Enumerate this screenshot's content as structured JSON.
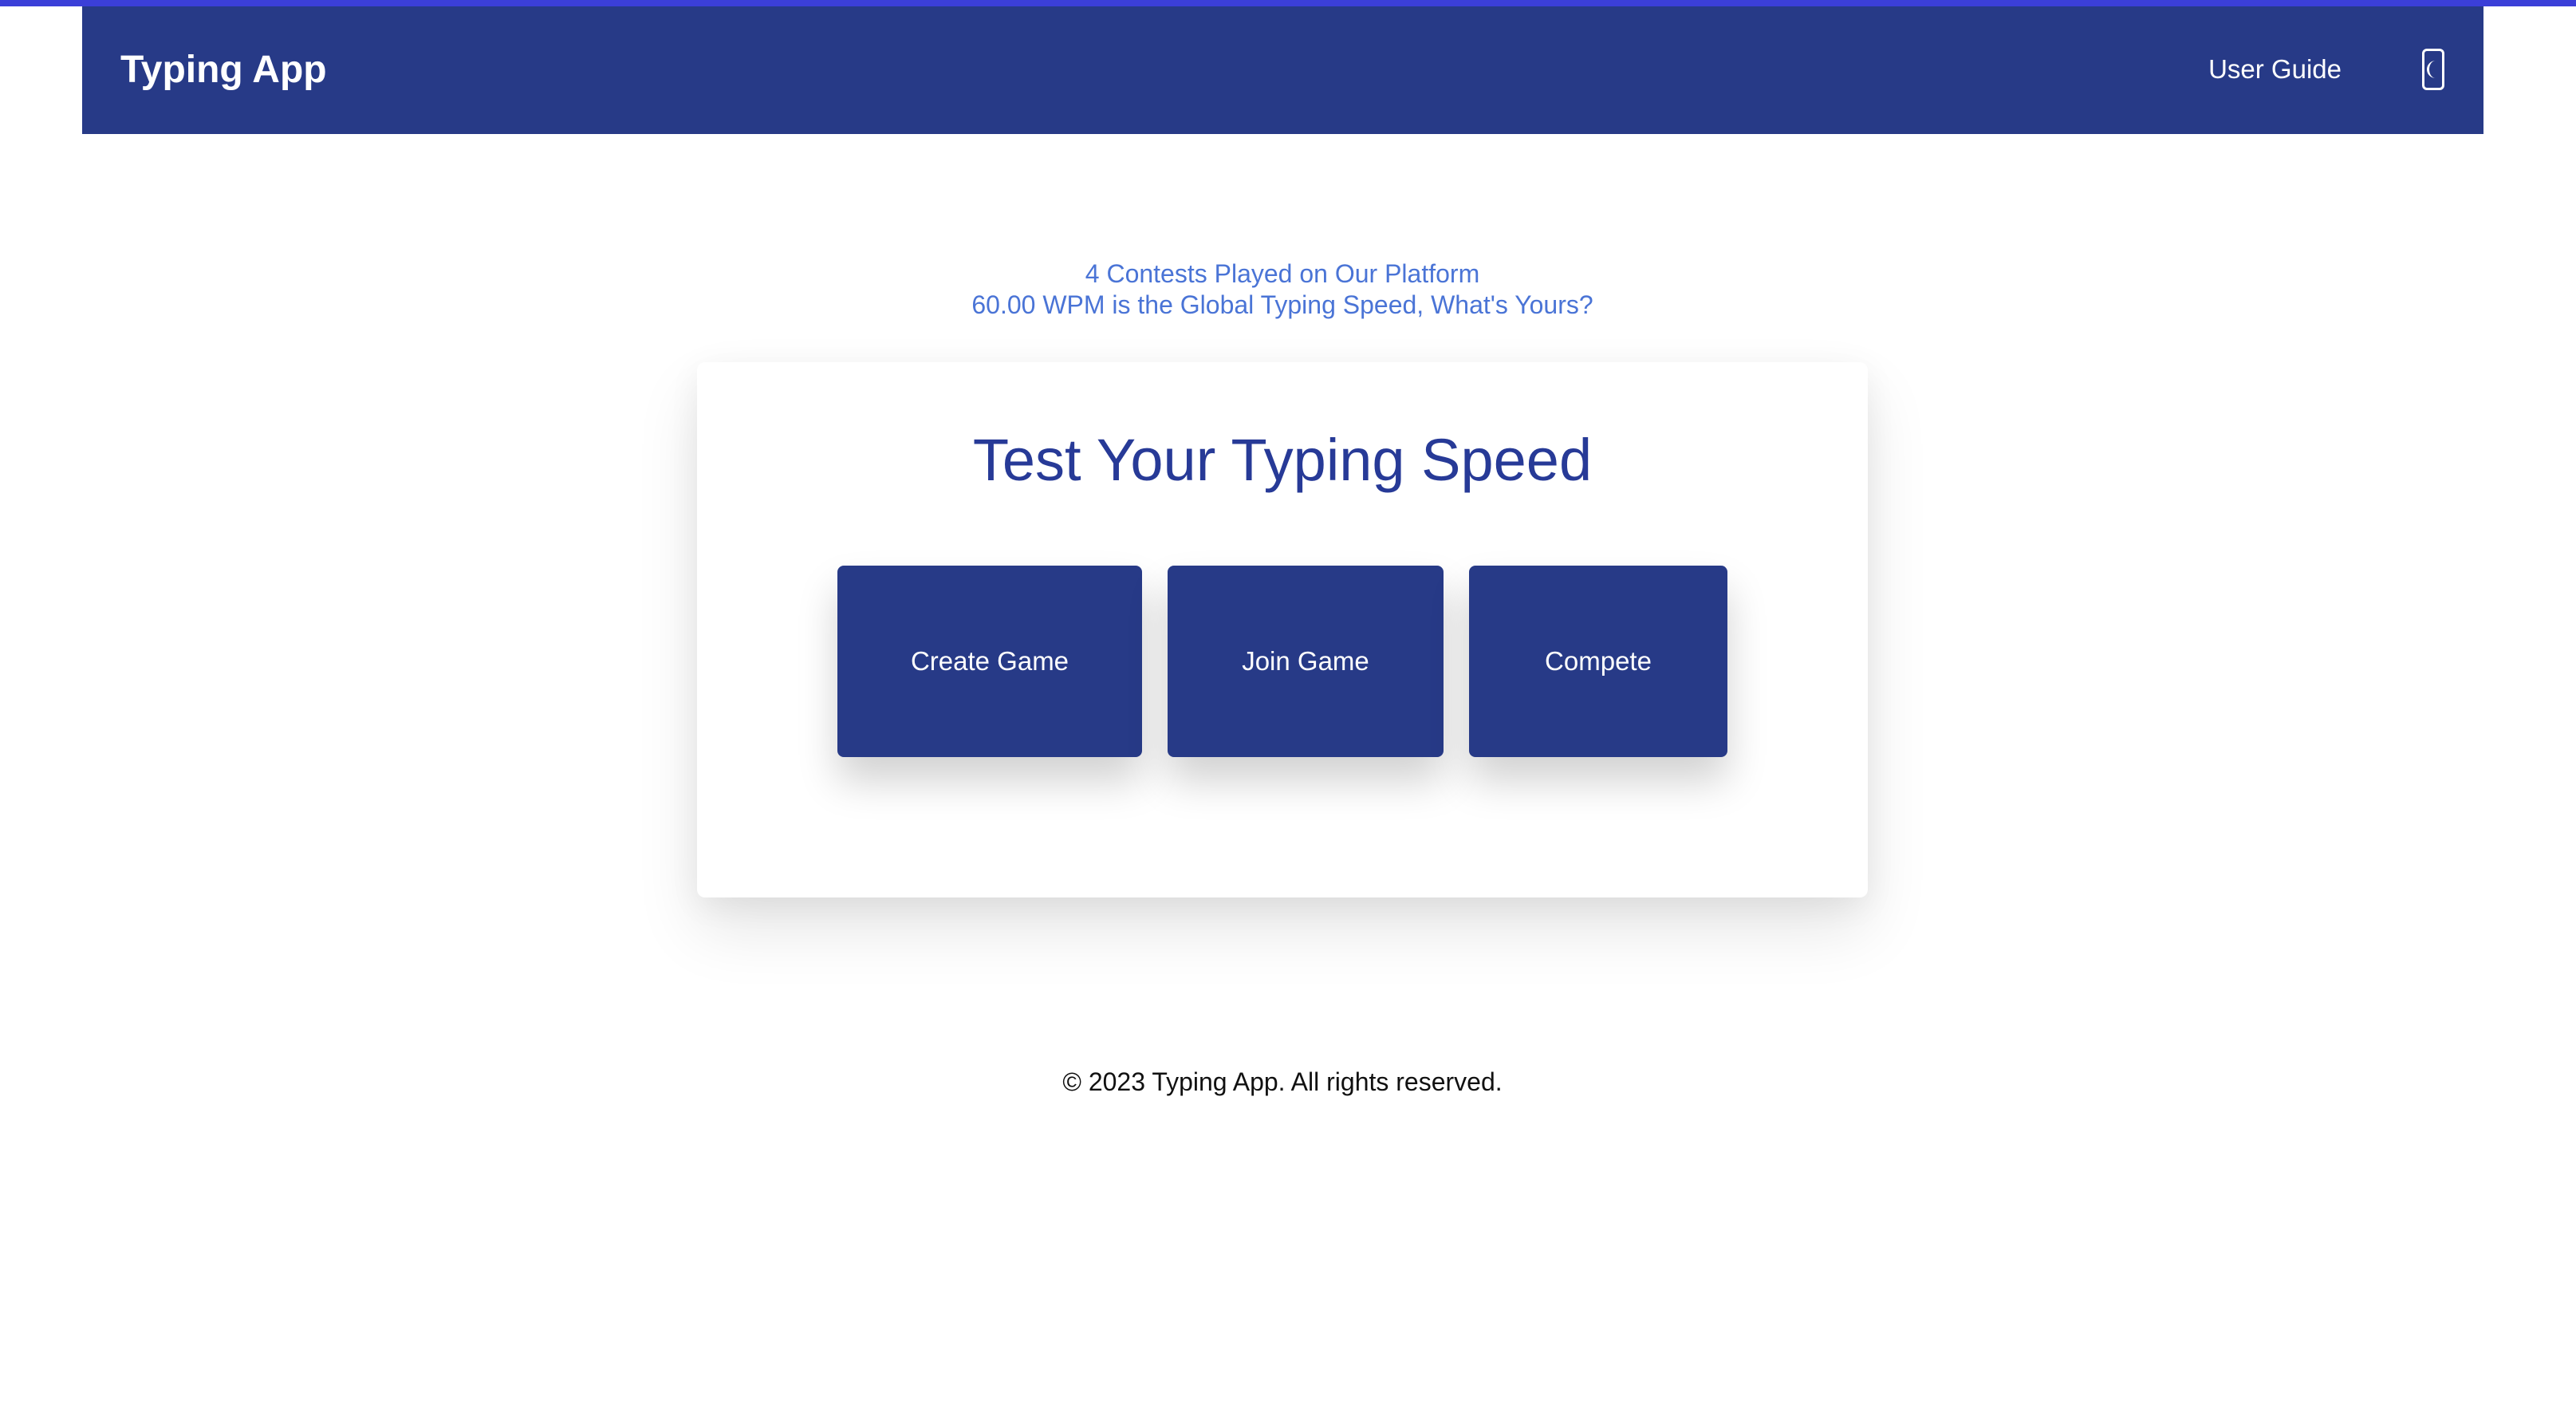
{
  "colors": {
    "top_accent": "#3b3fd8",
    "navbar_bg": "#273a87",
    "stats_text": "#4a74d6",
    "title_text": "#273a97",
    "button_bg": "#273a87"
  },
  "header": {
    "brand": "Typing App",
    "nav_user_guide": "User Guide",
    "theme_toggle_icon": "moon-icon"
  },
  "stats": {
    "contests": "4 Contests Played on Our Platform",
    "speed": "60.00 WPM is the Global Typing Speed, What's Yours?"
  },
  "main": {
    "title": "Test Your Typing Speed",
    "buttons": {
      "create": "Create Game",
      "join": "Join Game",
      "compete": "Compete"
    }
  },
  "footer": {
    "copyright": "© 2023 Typing App. All rights reserved."
  }
}
